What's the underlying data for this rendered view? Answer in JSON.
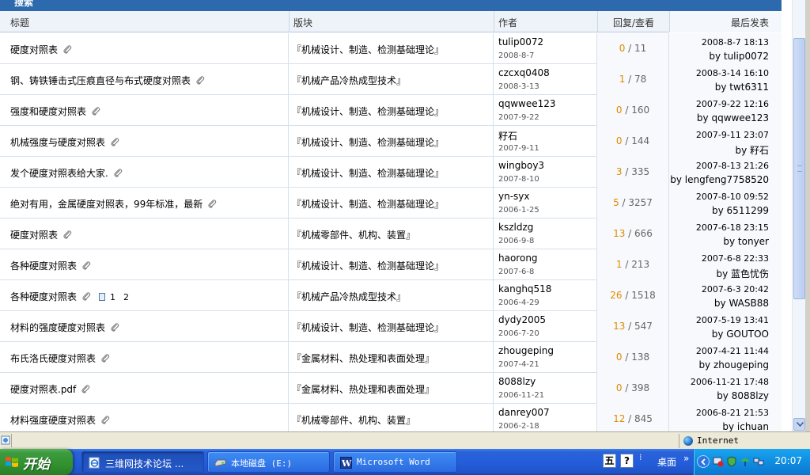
{
  "section_header": "搜索",
  "columns": {
    "title": "标题",
    "forum": "版块",
    "author": "作者",
    "replies": "回复/查看",
    "last_post": "最后发表"
  },
  "rows": [
    {
      "title": "硬度对照表",
      "forum": "『机械设计、制造、检测基础理论』",
      "author": "tulip0072",
      "author_date": "2008-8-7",
      "replies": "0",
      "views": "11",
      "last_time": "2008-8-7 18:13",
      "last_by": "by tulip0072"
    },
    {
      "title": "钢、铸铁锤击式压痕直径与布式硬度对照表",
      "forum": "『机械产品冷热成型技术』",
      "author": "czcxq0408",
      "author_date": "2008-3-13",
      "replies": "1",
      "views": "78",
      "last_time": "2008-3-14 16:10",
      "last_by": "by twt6311"
    },
    {
      "title": "强度和硬度对照表",
      "forum": "『机械设计、制造、检测基础理论』",
      "author": "qqwwee123",
      "author_date": "2007-9-22",
      "replies": "0",
      "views": "160",
      "last_time": "2007-9-22 12:16",
      "last_by": "by qqwwee123"
    },
    {
      "title": "机械强度与硬度对照表",
      "forum": "『机械设计、制造、检测基础理论』",
      "author": "籽石",
      "author_date": "2007-9-11",
      "replies": "0",
      "views": "144",
      "last_time": "2007-9-11 23:07",
      "last_by": "by 籽石"
    },
    {
      "title": "发个硬度对照表给大家.",
      "forum": "『机械设计、制造、检测基础理论』",
      "author": "wingboy3",
      "author_date": "2007-8-10",
      "replies": "3",
      "views": "335",
      "last_time": "2007-8-13 21:26",
      "last_by": "by lengfeng7758520"
    },
    {
      "title": "绝对有用，金属硬度对照表，99年标准，最新",
      "forum": "『机械设计、制造、检测基础理论』",
      "author": "yn-syx",
      "author_date": "2006-1-25",
      "replies": "5",
      "views": "3257",
      "last_time": "2007-8-10 09:52",
      "last_by": "by 6511299"
    },
    {
      "title": "硬度对照表",
      "forum": "『机械零部件、机构、装置』",
      "author": "kszldzg",
      "author_date": "2006-9-8",
      "replies": "13",
      "views": "666",
      "last_time": "2007-6-18 23:15",
      "last_by": "by tonyer"
    },
    {
      "title": "各种硬度对照表",
      "forum": "『机械设计、制造、检测基础理论』",
      "author": "haorong",
      "author_date": "2007-6-8",
      "replies": "1",
      "views": "213",
      "last_time": "2007-6-8 22:33",
      "last_by": "by 蓝色忧伤"
    },
    {
      "title": "各种硬度对照表",
      "forum": "『机械产品冷热成型技术』",
      "author": "kanghq518",
      "author_date": "2006-4-29",
      "replies": "26",
      "views": "1518",
      "last_time": "2007-6-3 20:42",
      "last_by": "by WASB88",
      "pages": [
        "1",
        "2"
      ]
    },
    {
      "title": "材料的强度硬度对照表",
      "forum": "『机械设计、制造、检测基础理论』",
      "author": "dydy2005",
      "author_date": "2006-7-20",
      "replies": "13",
      "views": "547",
      "last_time": "2007-5-19 13:41",
      "last_by": "by GOUTOO"
    },
    {
      "title": "布氏洛氏硬度对照表",
      "forum": "『金属材料、热处理和表面处理』",
      "author": "zhougeping",
      "author_date": "2007-4-21",
      "replies": "0",
      "views": "138",
      "last_time": "2007-4-21 11:44",
      "last_by": "by zhougeping"
    },
    {
      "title": "硬度对照表.pdf",
      "forum": "『金属材料、热处理和表面处理』",
      "author": "8088lzy",
      "author_date": "2006-11-21",
      "replies": "0",
      "views": "398",
      "last_time": "2006-11-21 17:48",
      "last_by": "by 8088lzy"
    },
    {
      "title": "材料强度硬度对照表",
      "forum": "『机械零部件、机构、装置』",
      "author": "danrey007",
      "author_date": "2006-2-18",
      "replies": "12",
      "views": "845",
      "last_time": "2006-8-21 21:53",
      "last_by": "by ichuan"
    }
  ],
  "statusbar": {
    "zone": "Internet"
  },
  "taskbar": {
    "start": "开始",
    "tasks": [
      {
        "label": "三维网技术论坛 ..."
      },
      {
        "label": "本地磁盘 (E:)"
      },
      {
        "label": "Microsoft Word"
      }
    ],
    "ime_cn": "五",
    "ime_help": "?",
    "desktop": "桌面",
    "chevron": "»",
    "clock": "20:07"
  },
  "colors": {
    "header_blue": "#2d6aad",
    "reply_orange": "#e08a00",
    "taskbar_blue": "#245edb",
    "start_green": "#31922f",
    "tray_blue": "#0f8de0"
  }
}
